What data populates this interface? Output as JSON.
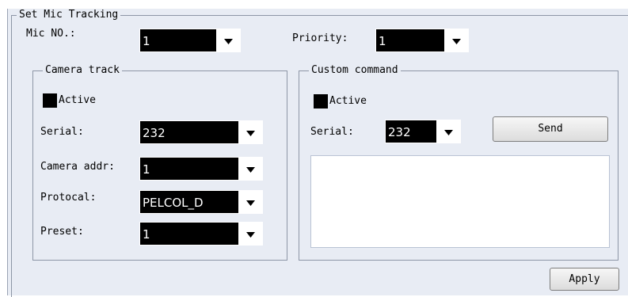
{
  "set_mic_tracking": {
    "title": "Set Mic Tracking",
    "mic_no_label": "Mic NO.:",
    "mic_no_value": "1",
    "priority_label": "Priority:",
    "priority_value": "1"
  },
  "camera_track": {
    "title": "Camera track",
    "active_label": "Active",
    "serial_label": "Serial:",
    "serial_value": "232",
    "camera_addr_label": "Camera addr:",
    "camera_addr_value": "1",
    "protocol_label": "Protocal:",
    "protocol_value": "PELCOL_D",
    "preset_label": "Preset:",
    "preset_value": "1"
  },
  "custom_command": {
    "title": "Custom command",
    "active_label": "Active",
    "serial_label": "Serial:",
    "serial_value": "232",
    "send_label": "Send",
    "command_text": ""
  },
  "apply_label": "Apply",
  "icons": {
    "dropdown": "chevron-down-icon",
    "checkbox": "checkbox-filled"
  },
  "colors": {
    "panel_bg": "#e8ecf4",
    "group_border": "#8d96a6",
    "selected_bg": "#000000"
  }
}
